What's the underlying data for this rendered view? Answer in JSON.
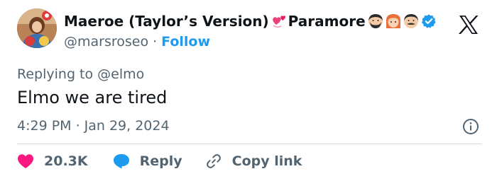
{
  "author": {
    "display_name": "Maeroe (Taylor’s Version)",
    "name_suffix": "Paramore",
    "handle": "@marsroseo",
    "follow_label": "Follow",
    "separator": "·"
  },
  "icons": {
    "avatar": "profile-photo",
    "heart_emoji": "revolving-hearts-emoji",
    "man_emoji": "bearded-man-emoji",
    "woman_emoji": "red-haired-woman-emoji",
    "man2_emoji": "mustached-man-emoji",
    "verified": "verified-badge-icon",
    "logo": "x-logo-icon",
    "info": "info-icon",
    "like": "heart-icon",
    "reply": "speech-bubble-icon",
    "link": "link-icon"
  },
  "reply_context": {
    "prefix": "Replying to",
    "mention": "@elmo"
  },
  "tweet": {
    "text": "Elmo we are tired",
    "time": "4:29 PM",
    "date": "Jan 29, 2024",
    "separator": "·"
  },
  "actions": {
    "likes_count": "20.3K",
    "reply_label": "Reply",
    "copy_link_label": "Copy link"
  },
  "colors": {
    "accent": "#1d9bf0",
    "like": "#f91880",
    "text_primary": "#0f1419",
    "text_secondary": "#536471",
    "divider": "#cfd9de"
  }
}
